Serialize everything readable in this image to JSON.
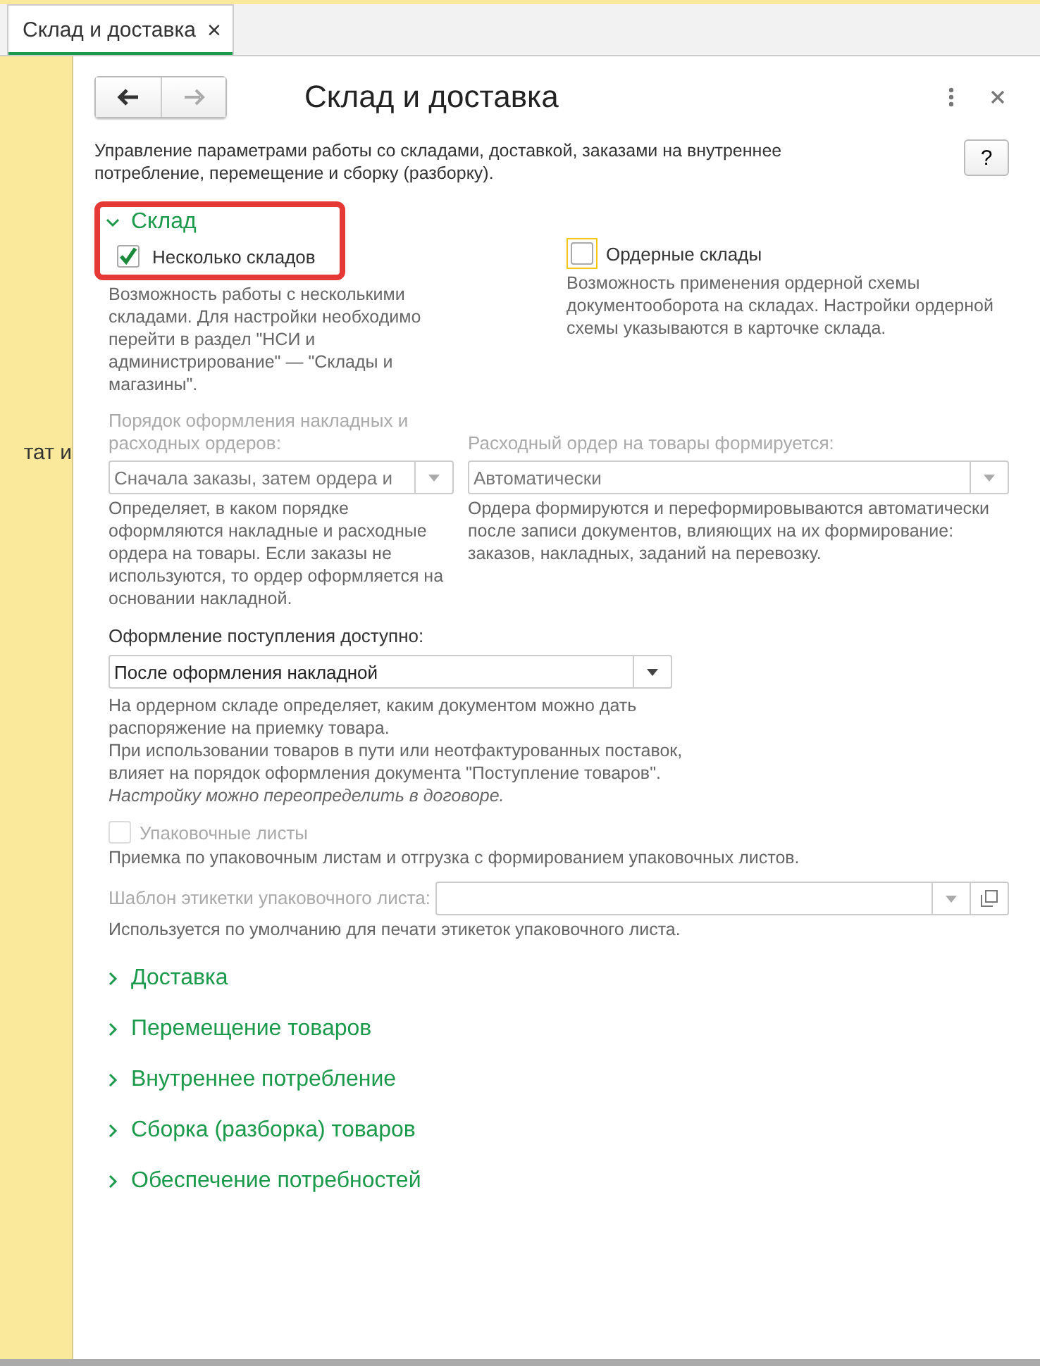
{
  "tab": {
    "label": "Склад и доставка",
    "close": "×",
    "selected": true
  },
  "sidebar": {
    "text": "тат и"
  },
  "form": {
    "title": "Склад и доставка",
    "description": "Управление параметрами работы со складами, доставкой, заказами на внутреннее потребление, перемещение и сборку (разборку).",
    "help": "?",
    "sections": [
      {
        "title": "Склад",
        "expanded": true,
        "highlighted": true,
        "checkboxes": [
          {
            "label": "Несколько складов",
            "checked": true,
            "focused": false,
            "hint": "Возможность работы с несколькими складами. Для настройки необходимо перейти в раздел \"НСИ и администрирование\" — \"Склады и магазины\"."
          },
          {
            "label": "Ордерные склады",
            "checked": false,
            "focused": true,
            "hint": "Возможность применения ордерной схемы документооборота на складах. Настройки ордерной схемы указываются в карточке склада."
          }
        ],
        "selects": [
          {
            "label": "Порядок оформления накладных и расходных ордеров:",
            "value": "Сначала заказы, затем ордера и",
            "disabled": true,
            "hint": "Определяет, в каком порядке оформляются накладные и расходные ордера на товары. Если заказы не используются, то ордер оформляется на основании накладной."
          },
          {
            "label": "Расходный ордер на товары формируется:",
            "value": "Автоматически",
            "disabled": true,
            "hint": "Ордера формируются и переформировываются автоматически после записи документов, влияющих на их формирование: заказов, накладных, заданий на перевозку."
          }
        ],
        "receipt": {
          "label": "Оформление поступления доступно:",
          "value": "После оформления накладной",
          "disabled": false,
          "hint": "На ордерном складе определяет, каким документом можно дать распоряжение на приемку товара.\nПри использовании товаров в пути или неотфактурованных поставок, влияет на порядок оформления документа \"Поступление товаров\".",
          "note": "Настройку можно переопределить в договоре."
        },
        "packing": {
          "label": "Упаковочные листы",
          "checked": false,
          "disabled": true,
          "hint": "Приемка по упаковочным листам и отгрузка с формированием упаковочных листов."
        },
        "template": {
          "label": "Шаблон этикетки упаковочного листа:",
          "disabled": true,
          "hint": "Используется по умолчанию для печати этикеток упаковочного листа."
        }
      },
      {
        "title": "Доставка",
        "expanded": false,
        "highlighted": false
      },
      {
        "title": "Перемещение товаров",
        "expanded": false,
        "highlighted": false
      },
      {
        "title": "Внутреннее потребление",
        "expanded": false,
        "highlighted": false
      },
      {
        "title": "Сборка (разборка) товаров",
        "expanded": false,
        "highlighted": false
      },
      {
        "title": "Обеспечение потребностей",
        "expanded": false,
        "highlighted": false
      }
    ]
  }
}
